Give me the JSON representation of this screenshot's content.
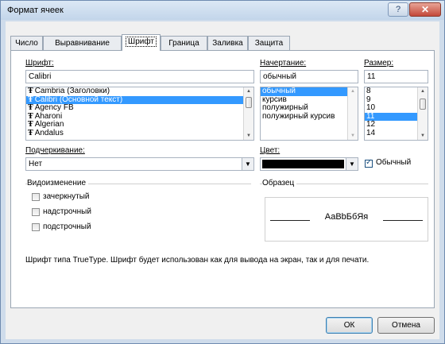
{
  "window": {
    "title": "Формат ячеек",
    "help_label": "?",
    "close_label": "✕"
  },
  "tabs": [
    {
      "label": "Число"
    },
    {
      "label": "Выравнивание"
    },
    {
      "label": "Шрифт"
    },
    {
      "label": "Граница"
    },
    {
      "label": "Заливка"
    },
    {
      "label": "Защита"
    }
  ],
  "font": {
    "label": "Шрифт:",
    "value": "Calibri",
    "items": [
      {
        "label": "Cambria (Заголовки)"
      },
      {
        "label": "Calibri (Основной текст)"
      },
      {
        "label": "Agency FB"
      },
      {
        "label": "Aharoni"
      },
      {
        "label": "Algerian"
      },
      {
        "label": "Andalus"
      }
    ]
  },
  "style": {
    "label": "Начертание:",
    "value": "обычный",
    "items": [
      {
        "label": "обычный"
      },
      {
        "label": "курсив"
      },
      {
        "label": "полужирный"
      },
      {
        "label": "полужирный курсив"
      }
    ]
  },
  "size": {
    "label": "Размер:",
    "value": "11",
    "items": [
      {
        "label": "8"
      },
      {
        "label": "9"
      },
      {
        "label": "10"
      },
      {
        "label": "11"
      },
      {
        "label": "12"
      },
      {
        "label": "14"
      }
    ]
  },
  "underline": {
    "label": "Подчеркивание:",
    "value": "Нет"
  },
  "color": {
    "label": "Цвет:",
    "swatch": "#000000",
    "normal_label": "Обычный",
    "normal_checked": true
  },
  "effects": {
    "label": "Видоизменение",
    "items": [
      {
        "label": "зачеркнутый",
        "checked": false
      },
      {
        "label": "надстрочный",
        "checked": false
      },
      {
        "label": "подстрочный",
        "checked": false
      }
    ]
  },
  "preview": {
    "label": "Образец",
    "text": "АаBbБбЯя"
  },
  "hint": "Шрифт типа TrueType. Шрифт будет использован как для вывода на экран, так и для печати.",
  "buttons": {
    "ok": "ОК",
    "cancel": "Отмена"
  }
}
